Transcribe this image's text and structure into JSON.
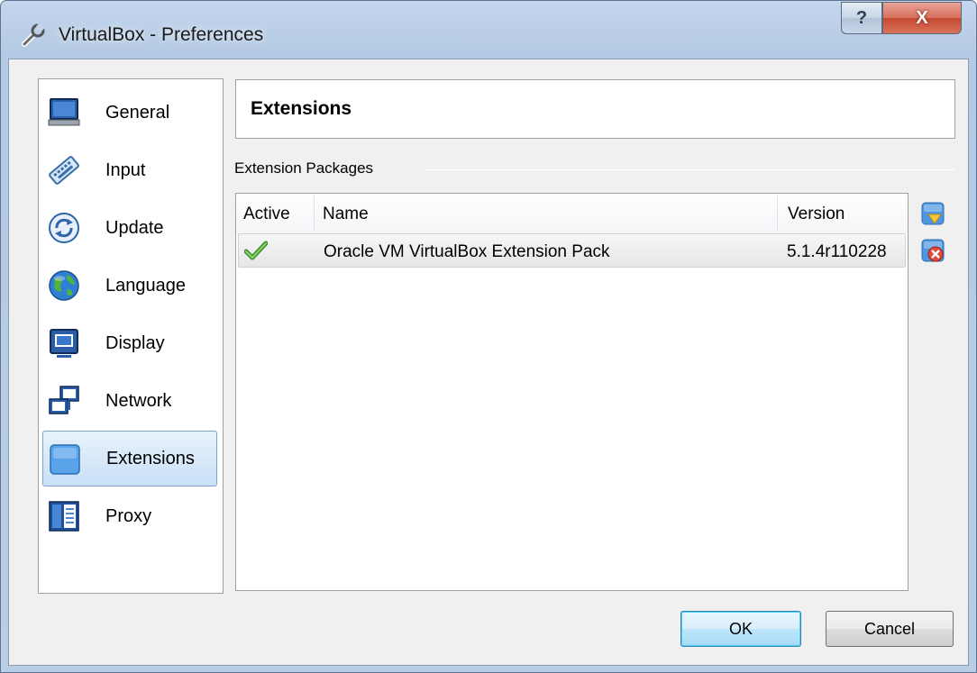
{
  "window": {
    "title": "VirtualBox - Preferences",
    "help_glyph": "?",
    "close_glyph": "X",
    "title_icon": "wrench-icon"
  },
  "sidebar": {
    "items": [
      {
        "label": "General",
        "icon": "monitor-icon"
      },
      {
        "label": "Input",
        "icon": "keyboard-icon"
      },
      {
        "label": "Update",
        "icon": "refresh-icon"
      },
      {
        "label": "Language",
        "icon": "globe-icon"
      },
      {
        "label": "Display",
        "icon": "display-icon"
      },
      {
        "label": "Network",
        "icon": "network-icon"
      },
      {
        "label": "Extensions",
        "icon": "puzzle-icon",
        "selected": true
      },
      {
        "label": "Proxy",
        "icon": "proxy-icon"
      }
    ]
  },
  "page": {
    "title": "Extensions",
    "group_label": "Extension Packages"
  },
  "list": {
    "columns": [
      "Active",
      "Name",
      "Version"
    ],
    "rows": [
      {
        "active": "check-icon",
        "name": "Oracle VM VirtualBox Extension Pack",
        "version": "5.1.4r110228"
      }
    ]
  },
  "tools": [
    "add-package-icon",
    "remove-package-icon"
  ],
  "buttons": {
    "ok": "OK",
    "cancel": "Cancel"
  },
  "colors": {
    "selection_bg": "#c9e0f7",
    "selection_border": "#7da2ce",
    "close_red": "#c44a30"
  }
}
